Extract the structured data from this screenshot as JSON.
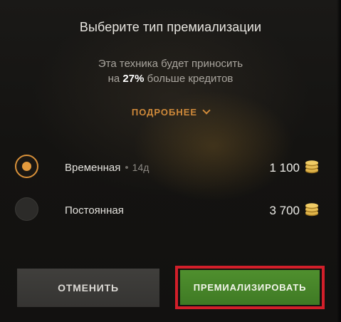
{
  "dialog": {
    "title": "Выберите тип премиализации",
    "description_line1": "Эта техника будет приносить",
    "description_prefix": "на",
    "description_percent": "27%",
    "description_suffix": "больше кредитов",
    "more_label": "ПОДРОБНЕЕ"
  },
  "options": [
    {
      "label": "Временная",
      "separator": "•",
      "duration": "14д",
      "price": "1 100",
      "selected": true
    },
    {
      "label": "Постоянная",
      "price": "3 700",
      "selected": false
    }
  ],
  "buttons": {
    "cancel_label": "ОТМЕНИТЬ",
    "confirm_label": "ПРЕМИАЛИЗИРОВАТЬ"
  },
  "colors": {
    "accent_orange": "#d9913a",
    "confirm_green": "#4a8a2b",
    "highlight_red": "#d21f2a"
  },
  "icons": {
    "currency": "credits-coins-icon",
    "more": "chevron-down-icon"
  }
}
